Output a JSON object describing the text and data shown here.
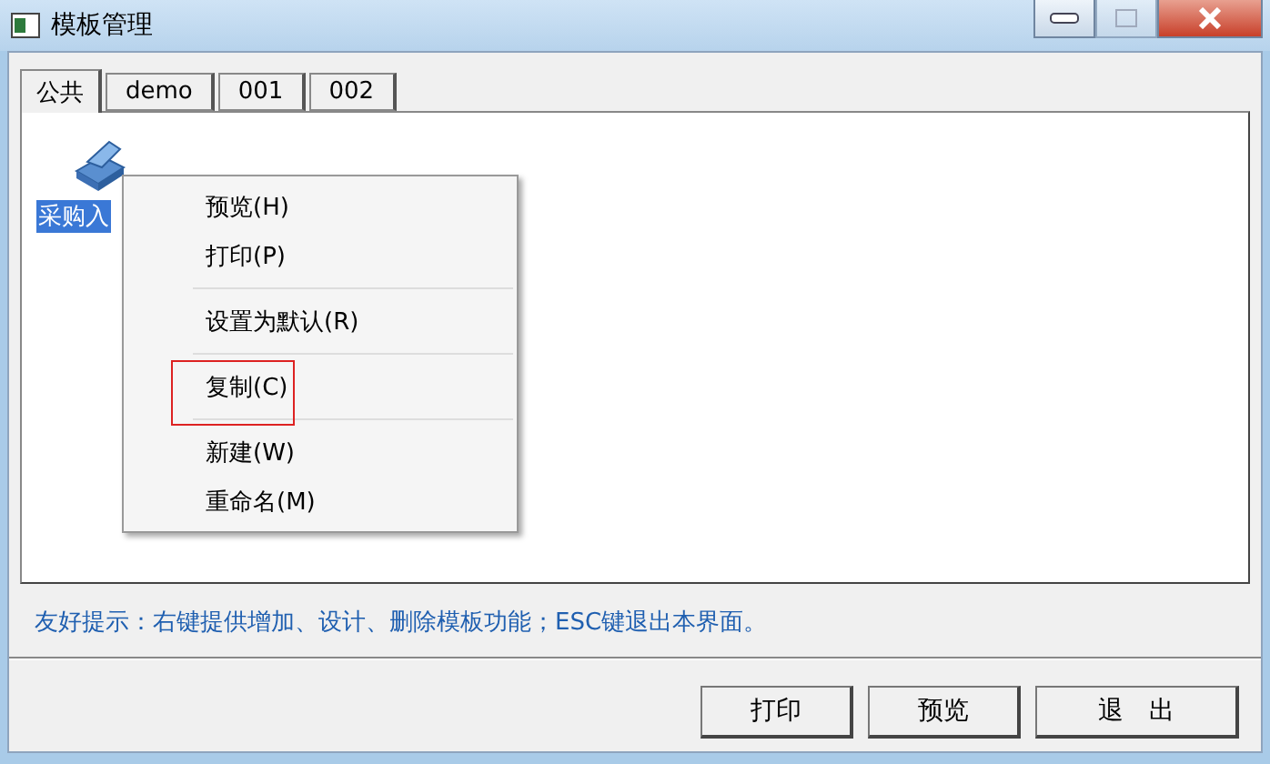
{
  "window": {
    "title": "模板管理"
  },
  "tabs": [
    {
      "label": "公共",
      "selected": true
    },
    {
      "label": "demo",
      "selected": false
    },
    {
      "label": "001",
      "selected": false
    },
    {
      "label": "002",
      "selected": false
    }
  ],
  "templates": [
    {
      "label": "采购入",
      "selected": true
    }
  ],
  "context_menu": {
    "groups": [
      [
        {
          "label": "预览(H)",
          "highlighted": false
        },
        {
          "label": "打印(P)",
          "highlighted": false
        }
      ],
      [
        {
          "label": "设置为默认(R)",
          "highlighted": false
        }
      ],
      [
        {
          "label": "复制(C)",
          "highlighted": true
        }
      ],
      [
        {
          "label": "新建(W)",
          "highlighted": false
        },
        {
          "label": "重命名(M)",
          "highlighted": false
        }
      ]
    ]
  },
  "hint": "友好提示：右键提供增加、设计、删除模板功能；ESC键退出本界面。",
  "buttons": [
    "打印",
    "预览",
    "退　出"
  ]
}
